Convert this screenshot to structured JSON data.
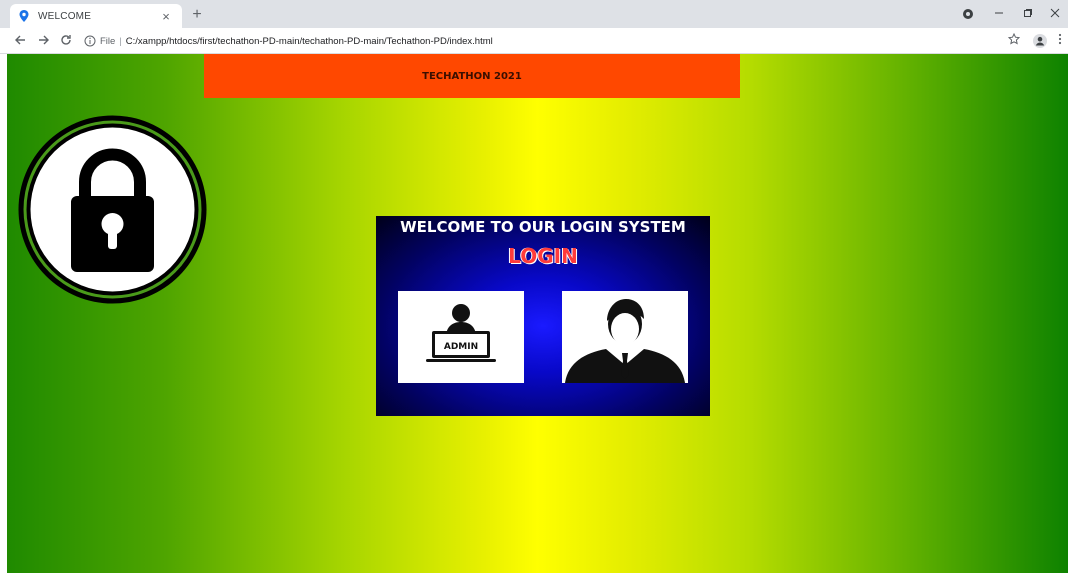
{
  "browser": {
    "tab_title": "WELCOME",
    "tab_close": "×",
    "new_tab": "+",
    "scheme_label": "File",
    "url": "C:/xampp/htdocs/first/techathon-PD-main/techathon-PD-main/Techathon-PD/index.html",
    "icons": {
      "favicon": "location-pin-icon",
      "back": "arrow-left-icon",
      "forward": "arrow-right-icon",
      "reload": "reload-icon",
      "info": "info-icon",
      "bookmark": "star-icon",
      "profile": "profile-icon",
      "menu": "kebab-menu-icon",
      "extension": "record-icon"
    }
  },
  "page": {
    "banner_text": "TECHATHON 2021",
    "welcome_heading": "WELCOME TO OUR LOGIN SYSTEM",
    "login_title": "LOGIN",
    "admin_label": "ADMIN",
    "colors": {
      "banner": "#ff4800",
      "login_text": "#ff3b3b",
      "box_center": "#1a1aff"
    }
  }
}
